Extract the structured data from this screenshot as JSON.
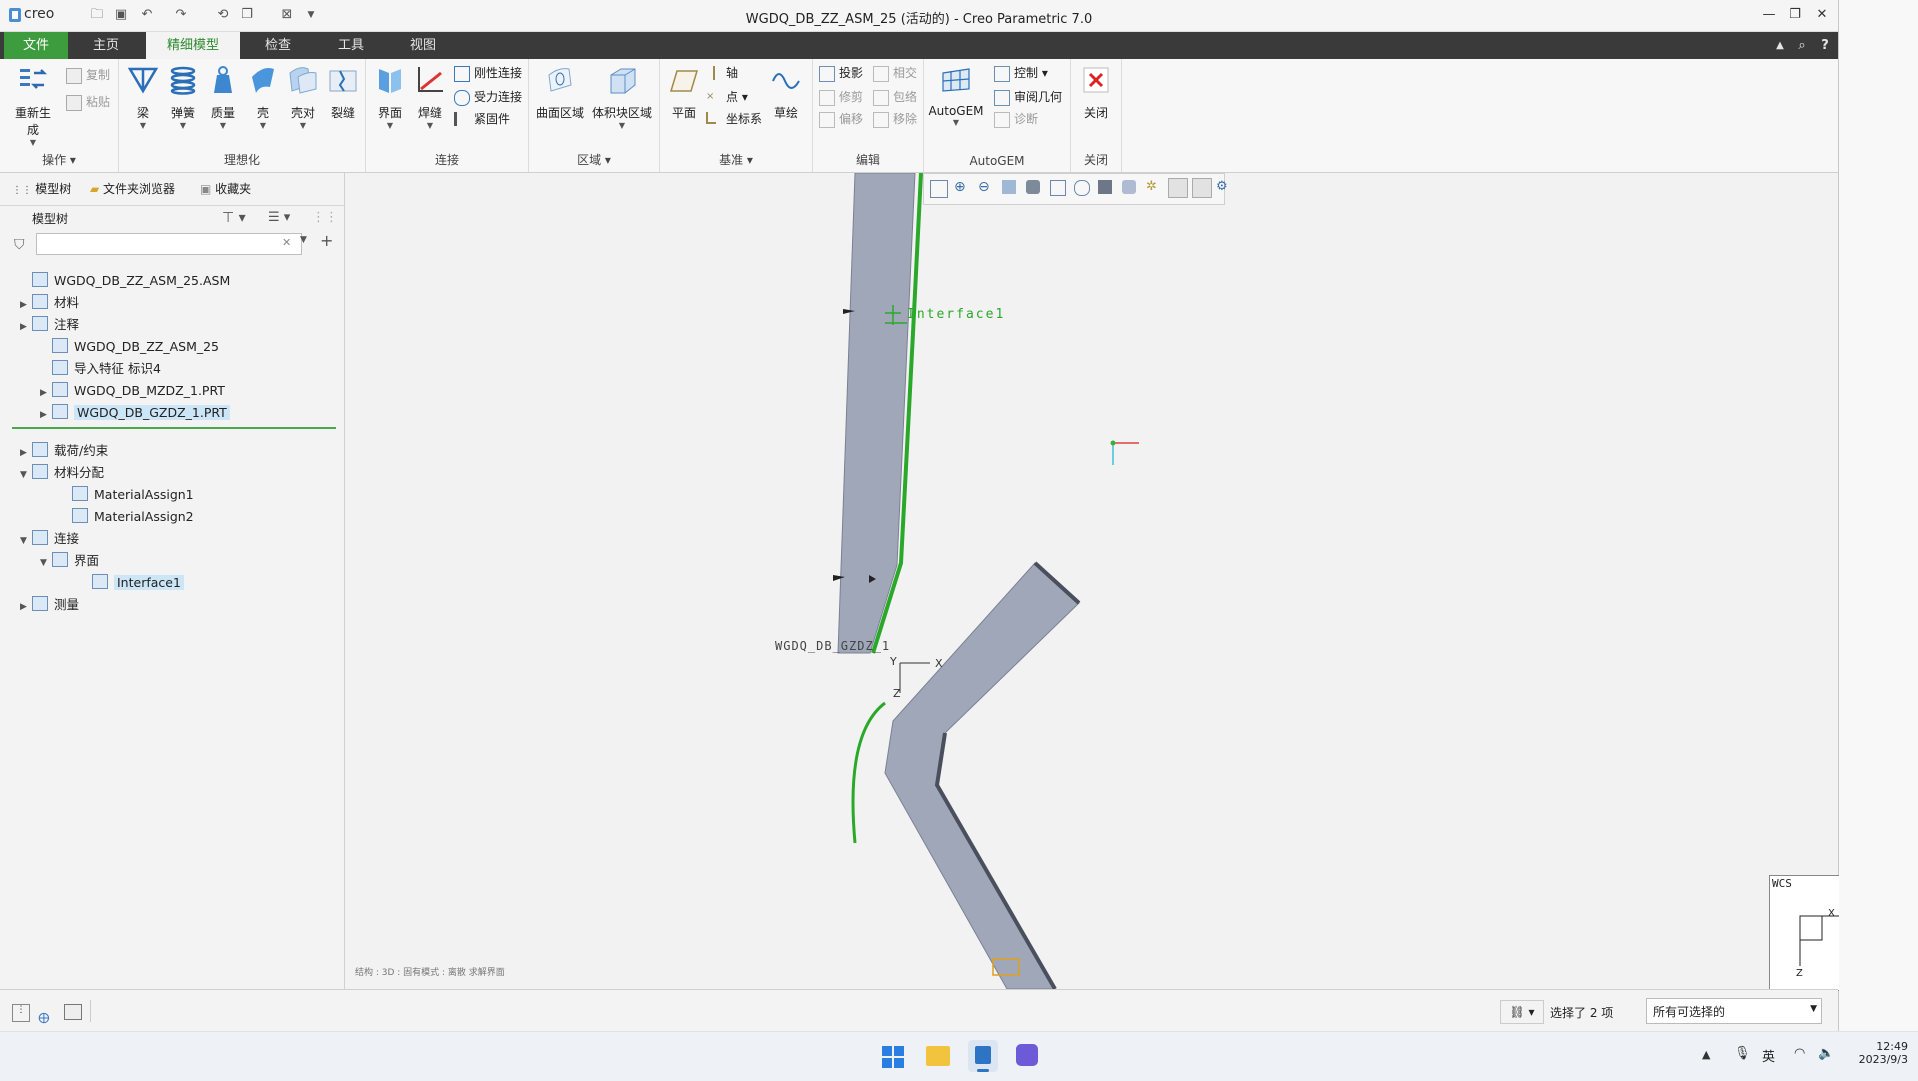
{
  "window": {
    "title": "WGDQ_DB_ZZ_ASM_25 (活动的) - Creo Parametric 7.0",
    "logo": "creo",
    "controls": [
      "minimize-icon",
      "maximize-icon",
      "close-icon"
    ]
  },
  "ribbon_tabs": [
    "文件",
    "主页",
    "精细模型",
    "检查",
    "工具",
    "视图"
  ],
  "active_tab": "精细模型",
  "ribbon": {
    "operations": {
      "label": "操作",
      "regen": "重新生成",
      "copy": "复制",
      "paste": "粘贴"
    },
    "idealization": {
      "label": "理想化",
      "beam": "梁",
      "spring": "弹簧",
      "mass": "质量",
      "shell": "壳",
      "shell_pair": "壳对",
      "crack": "裂缝"
    },
    "connection": {
      "label": "连接",
      "interface": "界面",
      "weld": "焊缝",
      "rigid": "刚性连接",
      "force": "受力连接",
      "fastener": "紧固件"
    },
    "region": {
      "label": "区域",
      "surface_region": "曲面区域",
      "volume_region": "体积块区域"
    },
    "datum": {
      "label": "基准",
      "plane": "平面",
      "axis": "轴",
      "point": "点",
      "csys": "坐标系",
      "sketch": "草绘"
    },
    "edit": {
      "label": "编辑",
      "project": "投影",
      "intersect": "相交",
      "trim": "修剪",
      "wrap": "包络",
      "offset": "偏移",
      "remove": "移除"
    },
    "autogem": {
      "label": "AutoGEM",
      "main": "AutoGEM",
      "control": "控制",
      "review": "审阅几何",
      "diagnose": "诊断"
    },
    "close": {
      "label": "关闭",
      "btn": "关闭"
    }
  },
  "left_panel": {
    "tabs": [
      "模型树",
      "文件夹浏览器",
      "收藏夹"
    ],
    "header": "模型树",
    "filter_placeholder": "",
    "tree_top": [
      {
        "label": "WGDQ_DB_ZZ_ASM_25.ASM",
        "toggle": "",
        "indent": 0
      },
      {
        "label": "材料",
        "toggle": "▶",
        "indent": 0
      },
      {
        "label": "注释",
        "toggle": "▶",
        "indent": 0
      },
      {
        "label": "WGDQ_DB_ZZ_ASM_25",
        "toggle": "",
        "indent": 1
      },
      {
        "label": "导入特征 标识4",
        "toggle": "",
        "indent": 1
      },
      {
        "label": "WGDQ_DB_MZDZ_1.PRT",
        "toggle": "▶",
        "indent": 1
      },
      {
        "label": "WGDQ_DB_GZDZ_1.PRT",
        "toggle": "▶",
        "indent": 1,
        "selected": true
      }
    ],
    "tree_bottom": [
      {
        "label": "载荷/约束",
        "toggle": "▶",
        "indent": 0
      },
      {
        "label": "材料分配",
        "toggle": "▼",
        "indent": 0
      },
      {
        "label": "MaterialAssign1",
        "toggle": "",
        "indent": 2
      },
      {
        "label": "MaterialAssign2",
        "toggle": "",
        "indent": 2
      },
      {
        "label": "连接",
        "toggle": "▼",
        "indent": 0
      },
      {
        "label": "界面",
        "toggle": "▼",
        "indent": 1
      },
      {
        "label": "Interface1",
        "toggle": "",
        "indent": 3,
        "selected": true
      },
      {
        "label": "测量",
        "toggle": "▶",
        "indent": 0
      }
    ]
  },
  "graphics": {
    "interface_label": "Interface1",
    "part_label": "WGDQ_DB_GZDZ_1",
    "csys_x": "X",
    "csys_y": "Y",
    "csys_z": "Z",
    "wcs_label": "WCS",
    "wcs_x": "X",
    "wcs_z": "Z",
    "footer_text": "结构 : 3D : 固有模式 : 离散 求解界面"
  },
  "status_bar": {
    "selected": "选择了 2 项",
    "filter": "所有可选择的"
  },
  "taskbar": {
    "ime": "英",
    "time": "12:49",
    "date": "2023/9/3"
  }
}
